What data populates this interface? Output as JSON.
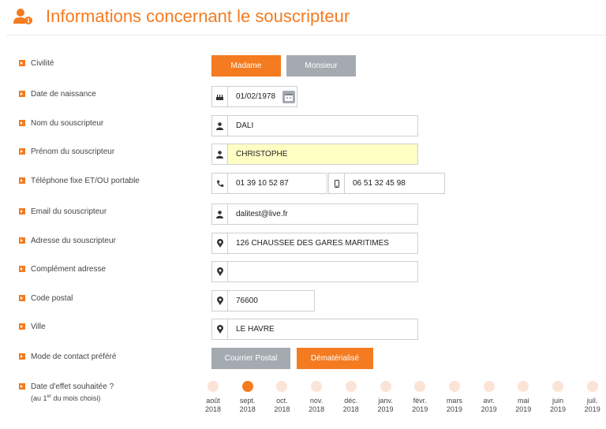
{
  "header": {
    "title": "Informations concernant le souscripteur",
    "icon": "user-info-icon",
    "accent": "#f47b20"
  },
  "form": {
    "civilite": {
      "label": "Civilité",
      "options": [
        "Madame",
        "Monsieur"
      ],
      "selected": "Madame"
    },
    "birthdate": {
      "label": "Date de naissance",
      "value": "01/02/1978"
    },
    "nom": {
      "label": "Nom du souscripteur",
      "value": "DALI"
    },
    "prenom": {
      "label": "Prénom du souscripteur",
      "value": "CHRISTOPHE"
    },
    "telephone": {
      "label": "Téléphone fixe ET/OU portable",
      "fixe": "01 39 10 52 87",
      "portable": "06 51 32 45 98"
    },
    "email": {
      "label": "Email du souscripteur",
      "value": "dalitest@live.fr"
    },
    "adresse": {
      "label": "Adresse du souscripteur",
      "value": "126 CHAUSSEE DES GARES MARITIMES"
    },
    "complement": {
      "label": "Complément adresse",
      "value": ""
    },
    "code_postal": {
      "label": "Code postal",
      "value": "76600"
    },
    "ville": {
      "label": "Ville",
      "value": "LE HAVRE"
    },
    "contact": {
      "label": "Mode de contact préféré",
      "options": [
        "Courrier Postal",
        "Dématérialisé"
      ],
      "selected": "Dématérialisé"
    },
    "date_effet": {
      "label": "Date d'effet souhaitée ?",
      "sublabel_prefix": "(au 1",
      "sublabel_sup": "er",
      "sublabel_suffix": " du mois choisi)",
      "selected": "sept. 2018",
      "months": [
        {
          "month": "août",
          "year": "2018"
        },
        {
          "month": "sept.",
          "year": "2018"
        },
        {
          "month": "oct.",
          "year": "2018"
        },
        {
          "month": "nov.",
          "year": "2018"
        },
        {
          "month": "déc.",
          "year": "2018"
        },
        {
          "month": "janv.",
          "year": "2019"
        },
        {
          "month": "févr.",
          "year": "2019"
        },
        {
          "month": "mars",
          "year": "2019"
        },
        {
          "month": "avr.",
          "year": "2019"
        },
        {
          "month": "mai",
          "year": "2019"
        },
        {
          "month": "juin",
          "year": "2019"
        },
        {
          "month": "juil.",
          "year": "2019"
        }
      ]
    }
  }
}
